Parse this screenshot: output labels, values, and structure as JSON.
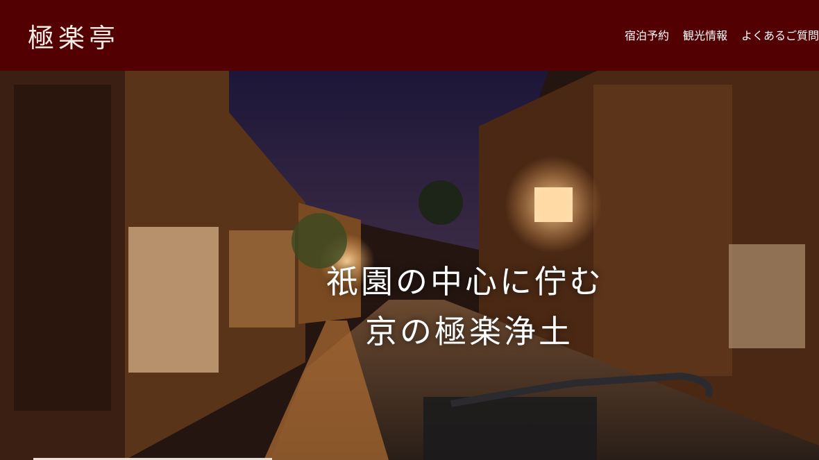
{
  "header": {
    "logo": "極楽亭",
    "nav": [
      "宿泊予約",
      "観光情報",
      "よくあるご質問"
    ]
  },
  "hero": {
    "line1": "祇園の中心に佇む",
    "line2": "京の極楽浄土"
  },
  "colors": {
    "header_bg": "#520002",
    "text": "#ffffff"
  }
}
